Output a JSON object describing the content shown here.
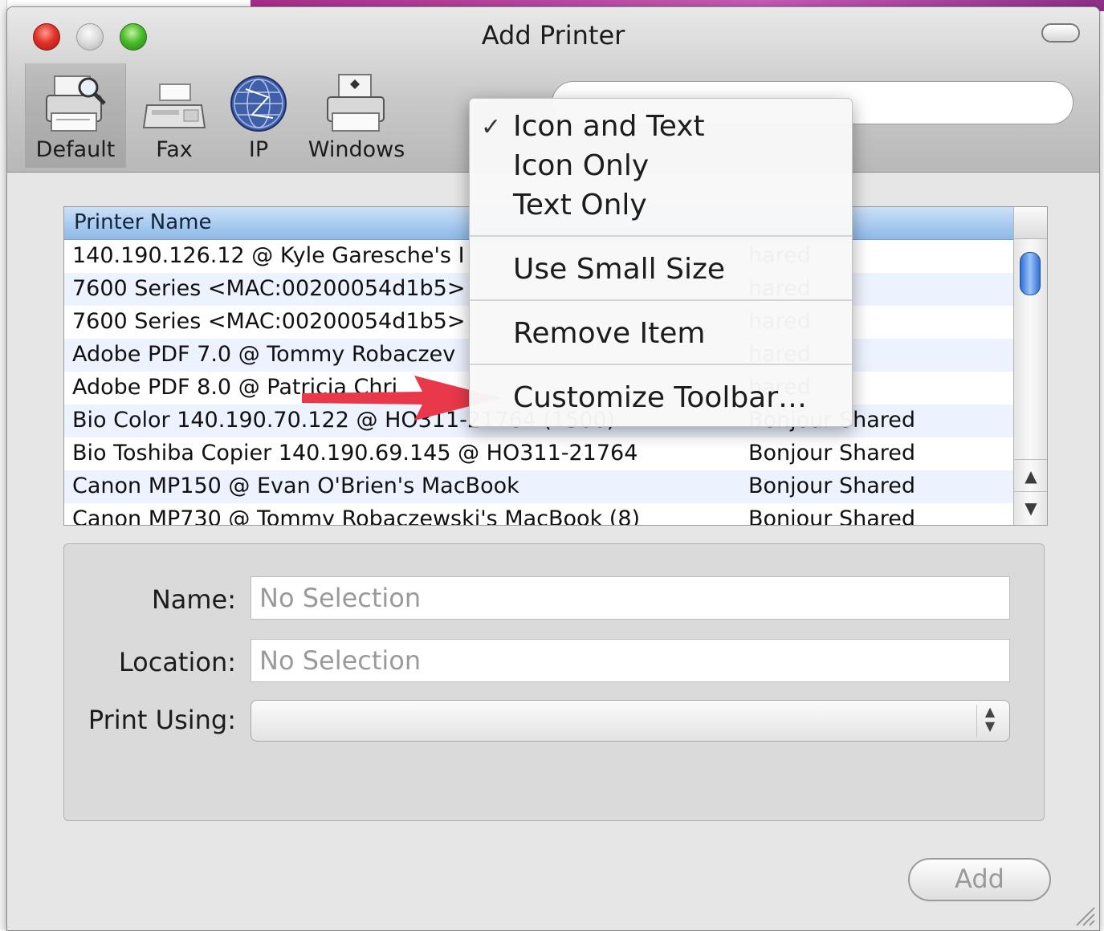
{
  "window": {
    "title": "Add Printer"
  },
  "toolbar": {
    "items": [
      {
        "label": "Default",
        "icon": "printer-search-icon",
        "selected": true
      },
      {
        "label": "Fax",
        "icon": "fax-icon"
      },
      {
        "label": "IP",
        "icon": "globe-icon"
      },
      {
        "label": "Windows",
        "icon": "windows-printer-icon"
      }
    ],
    "search_placeholder": ""
  },
  "table": {
    "columns": [
      "Printer Name"
    ],
    "rows": [
      {
        "name": "140.190.126.12 @ Kyle Garesche's I",
        "kind": "hared"
      },
      {
        "name": "7600 Series <MAC:00200054d1b5>",
        "kind": "hared"
      },
      {
        "name": "7600 Series <MAC:00200054d1b5>",
        "kind": "hared"
      },
      {
        "name": "Adobe PDF 7.0 @ Tommy  Robaczev",
        "kind": "hared"
      },
      {
        "name": "Adobe PDF 8.0 @ Patricia Chri",
        "kind": "hared"
      },
      {
        "name": "Bio Color 140.190.70.122 @ HO311-21764 (1500)",
        "kind": "Bonjour Shared"
      },
      {
        "name": "Bio Toshiba Copier 140.190.69.145 @ HO311-21764",
        "kind": "Bonjour Shared"
      },
      {
        "name": "Canon MP150 @ Evan O'Brien's MacBook",
        "kind": "Bonjour Shared"
      },
      {
        "name": "Canon MP730 @ Tommy  Robaczewski's MacBook (8)",
        "kind": "Bonjour Shared"
      }
    ]
  },
  "context_menu": {
    "items": [
      {
        "label": "Icon and Text",
        "checked": true
      },
      {
        "label": "Icon Only"
      },
      {
        "label": "Text Only"
      },
      {
        "label": "Use Small Size"
      },
      {
        "label": "Remove Item"
      },
      {
        "label": "Customize Toolbar…"
      }
    ],
    "check_glyph": "✓"
  },
  "details": {
    "name_label": "Name:",
    "name_value": "No Selection",
    "location_label": "Location:",
    "location_value": "No Selection",
    "print_using_label": "Print Using:",
    "print_using_value": ""
  },
  "buttons": {
    "add": "Add"
  },
  "colors": {
    "annotation_arrow": "#e8384a",
    "selection_blue": "#8db9e8",
    "alt_row": "#edf3fe"
  }
}
